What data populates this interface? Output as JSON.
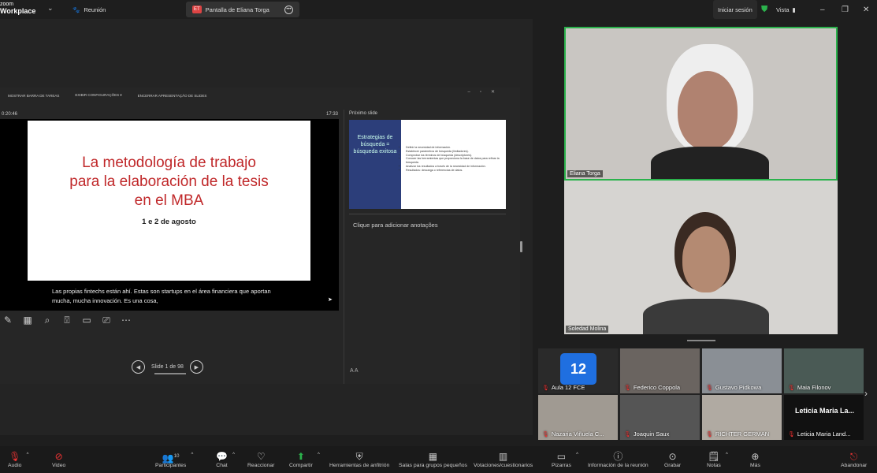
{
  "app": {
    "logo_top": "zoom",
    "logo_bottom": "Workplace"
  },
  "tabs": [
    {
      "label": "Reunión"
    },
    {
      "label": "Pantalla de Eliana Torga",
      "badge": "ET"
    }
  ],
  "topright": {
    "signin": "Iniciar sesión",
    "view": "Vista"
  },
  "presenter": {
    "toolbar": [
      "MOSTRAR BARRA DE TAREAS",
      "EXIBIR CONFIGURAÇÕES ▾",
      "ENCERRAR APRESENTAÇÃO DE SLIDES"
    ],
    "timer": "0:20:46",
    "clock": "17:33",
    "slide_title_lines": [
      "La metodología de trabajo",
      "para la elaboración de la tesis",
      "en el MBA"
    ],
    "slide_date": "1 e 2 de agosto",
    "caption": "Las propias fintechs están ahí. Estas son startups en el área financiera que aportan mucha, mucha innovación. Es una cosa,",
    "next_label": "Próximo slide",
    "next_title": "Estrategias de búsqueda = búsqueda exitosa",
    "next_bullets": [
      "Definir la necesidad de información.",
      "Establecer parámetros de búsqueda (limitadores).",
      "Comprobar los términos de búsqueda (descriptores).",
      "Conocer las herramientas que proporciona la base de datos para refinar la búsqueda.",
      "Analizar los resultados a través de la necesidad de información.",
      "Resultados: descarga o referencias de datos."
    ],
    "notes_placeholder": "Clique para adicionar anotações",
    "slide_counter": "Slide 1 de 98"
  },
  "videos": [
    {
      "name": "Eliana Torga"
    },
    {
      "name": "Soledad Molina"
    }
  ],
  "gallery": [
    {
      "name": "Aula 12 FCE",
      "tile_text": "12"
    },
    {
      "name": "Federico Coppola"
    },
    {
      "name": "Gustavo Pidkowa"
    },
    {
      "name": "Maia Filonov"
    },
    {
      "name": "Nazaria Viñuela C..."
    },
    {
      "name": "Joaquin Saux"
    },
    {
      "name": "RICHTER GERMAN"
    },
    {
      "name": "Leticia Maria Land...",
      "tile_text": "Leticia Maria La..."
    }
  ],
  "bottom": {
    "audio": "Audio",
    "video": "Video",
    "participants": "Participantes",
    "participants_count": "10",
    "chat": "Chat",
    "react": "Reaccionar",
    "share": "Compartir",
    "host_tools": "Herramientas de anfitrión",
    "breakout": "Salas para grupos pequeños",
    "polls": "Votaciones/cuestionarios",
    "whiteboards": "Pizarras",
    "info": "Información de la reunión",
    "record": "Grabar",
    "notes": "Notas",
    "more": "Más",
    "leave": "Abandonar"
  }
}
